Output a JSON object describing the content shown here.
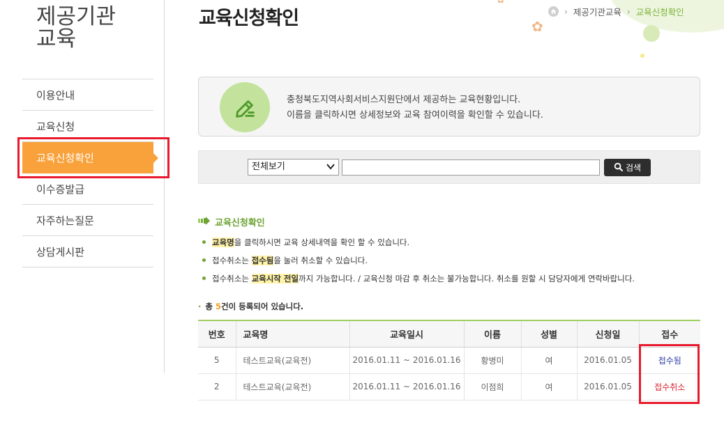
{
  "sidebar": {
    "title_line1": "제공기관",
    "title_line2": "교육",
    "items": [
      {
        "label": "이용안내"
      },
      {
        "label": "교육신청"
      },
      {
        "label": "교육신청확인"
      },
      {
        "label": "이수증발급"
      },
      {
        "label": "자주하는질문"
      },
      {
        "label": "상담게시판"
      }
    ],
    "active_index": 2
  },
  "header": {
    "title": "교육신청확인",
    "breadcrumb": [
      "제공기관교육",
      "교육신청확인"
    ]
  },
  "info": {
    "line1": "충청북도지역사회서비스지원단에서 제공하는 교육현황입니다.",
    "line2": "이름을 클릭하시면 상세정보와 교육 참여이력을 확인할 수 있습니다."
  },
  "search": {
    "select_value": "전체보기",
    "input_value": "",
    "button_label": "검색"
  },
  "section": {
    "title": "교육신청확인",
    "notes": [
      {
        "pre": "",
        "hl": "교육명",
        "post": "을 클릭하시면 교육 상세내역을 확인 할 수 있습니다."
      },
      {
        "pre": "접수취소는 ",
        "hl": "접수됨",
        "post": "을 눌러 취소할 수 있습니다."
      },
      {
        "pre": "접수취소는 ",
        "hl": "교육시작 전일",
        "post": "까지 가능합니다. / 교육신청 마감 후 취소는 불가능합니다. 취소를 원할 시 담당자에게 연락바랍니다."
      }
    ],
    "total_prefix": "총 ",
    "total_count": "5",
    "total_suffix": "건이 등록되어 있습니다."
  },
  "table": {
    "headers": [
      "번호",
      "교육명",
      "교육일시",
      "이름",
      "성별",
      "신청일",
      "접수"
    ],
    "rows": [
      {
        "no": "5",
        "name": "테스트교육(교육전)",
        "period": "2016.01.11 ~ 2016.01.16",
        "person": "황병미",
        "gender": "여",
        "applied": "2016.01.05",
        "status": "접수됨",
        "status_type": "done"
      },
      {
        "no": "2",
        "name": "테스트교육(교육전)",
        "period": "2016.01.11 ~ 2016.01.16",
        "person": "이점희",
        "gender": "여",
        "applied": "2016.01.05",
        "status": "접수취소",
        "status_type": "cancel"
      }
    ]
  },
  "colors": {
    "accent_green": "#6da334",
    "active_orange": "#f9a13a",
    "highlight_red": "#e8192c"
  },
  "icons": [
    "home-icon",
    "pencil-icon",
    "search-icon",
    "chevron-down-icon",
    "arrow-right-icon"
  ]
}
